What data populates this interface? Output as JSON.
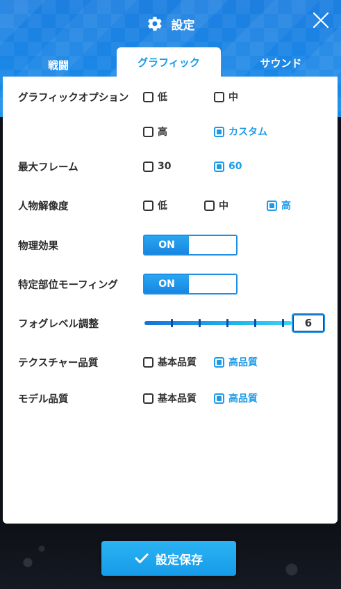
{
  "header": {
    "title": "設定"
  },
  "tabs": [
    {
      "label": "戦闘"
    },
    {
      "label": "グラフィック"
    },
    {
      "label": "サウンド"
    }
  ],
  "settings": {
    "graphics_option": {
      "label": "グラフィックオプション",
      "options": [
        "低",
        "中",
        "高",
        "カスタム"
      ],
      "selected": "カスタム"
    },
    "max_frame": {
      "label": "最大フレーム",
      "options": [
        "30",
        "60"
      ],
      "selected": "60"
    },
    "character_resolution": {
      "label": "人物解像度",
      "options": [
        "低",
        "中",
        "高"
      ],
      "selected": "高"
    },
    "physics": {
      "label": "物理効果",
      "state": "ON"
    },
    "morphing": {
      "label": "特定部位モーフィング",
      "state": "ON"
    },
    "fog_level": {
      "label": "フォグレベル調整",
      "value": "6",
      "max": 6
    },
    "texture_quality": {
      "label": "テクスチャー品質",
      "options": [
        "基本品質",
        "高品質"
      ],
      "selected": "高品質"
    },
    "model_quality": {
      "label": "モデル品質",
      "options": [
        "基本品質",
        "高品質"
      ],
      "selected": "高品質"
    }
  },
  "footer": {
    "save_label": "設定保存"
  },
  "colors": {
    "accent": "#1d9be8",
    "header": "#1a86e6",
    "background": "#0d1016"
  },
  "icons": {
    "title": "gear-icon",
    "close": "close-icon",
    "save": "check-icon"
  }
}
